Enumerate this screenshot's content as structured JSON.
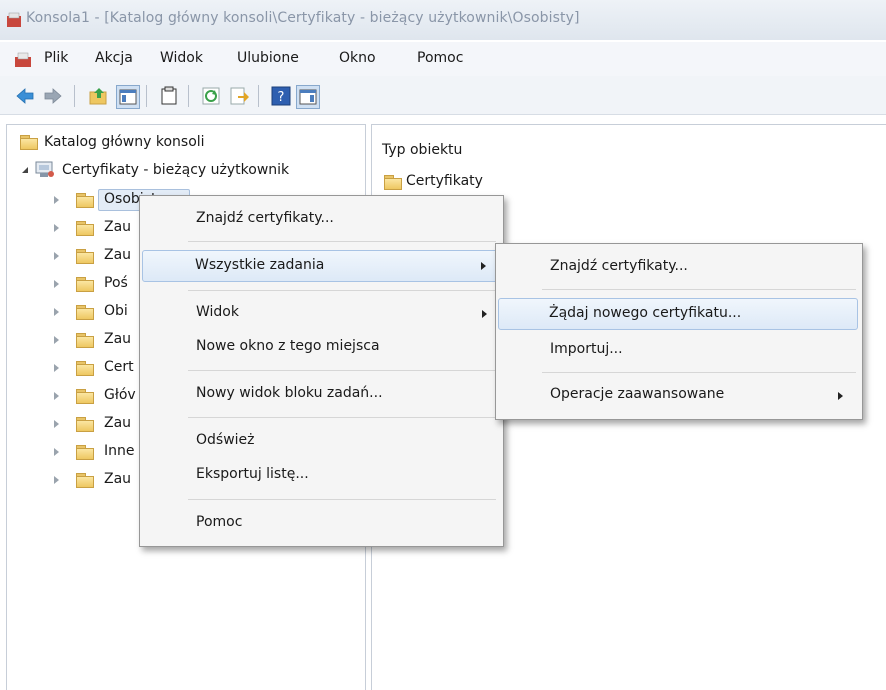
{
  "window": {
    "title": "Konsola1 - [Katalog główny konsoli\\Certyfikaty - bieżący użytkownik\\Osobisty]"
  },
  "menubar": {
    "items": [
      "Plik",
      "Akcja",
      "Widok",
      "Ulubione",
      "Okno",
      "Pomoc"
    ]
  },
  "toolbar": {
    "icons": [
      "back-arrow-icon",
      "forward-arrow-icon",
      "up-folder-icon",
      "show-hide-tree-icon",
      "properties-icon",
      "refresh-icon",
      "export-list-icon",
      "help-icon",
      "show-action-pane-icon"
    ]
  },
  "tree": {
    "root": "Katalog główny konsoli",
    "certs": "Certyfikaty - bieżący użytkownik",
    "children": [
      "Osobisty",
      "Zau",
      "Zau",
      "Poś",
      "Obi",
      "Zau",
      "Cert",
      "Głóv",
      "Zau",
      "Inne",
      "Zau"
    ]
  },
  "right": {
    "column_header": "Typ obiektu",
    "items": [
      "Certyfikaty"
    ]
  },
  "context_menu": {
    "items": [
      "Znajdź certyfikaty...",
      "Wszystkie zadania",
      "Widok",
      "Nowe okno z tego miejsca",
      "Nowy widok bloku zadań...",
      "Odśwież",
      "Eksportuj listę...",
      "Pomoc"
    ]
  },
  "submenu": {
    "items": [
      "Znajdź certyfikaty...",
      "Żądaj nowego certyfikatu...",
      "Importuj...",
      "Operacje zaawansowane"
    ]
  },
  "colors": {
    "highlight": "#dde9f7",
    "folder": "#eec761",
    "menu_bg": "#f5f5f5"
  }
}
